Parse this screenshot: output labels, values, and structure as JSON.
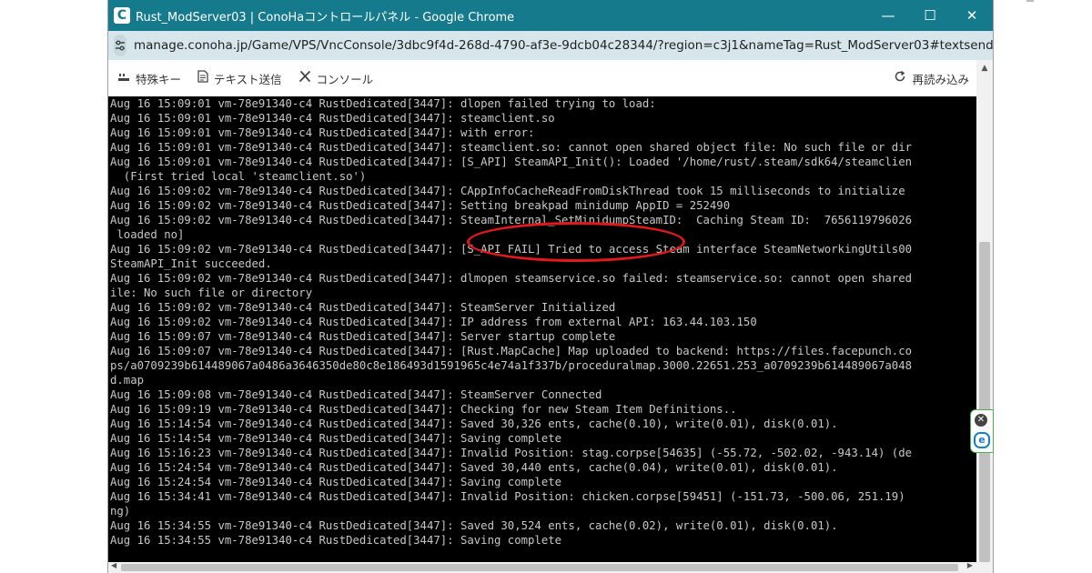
{
  "window": {
    "title": "Rust_ModServer03 | ConoHaコントロールパネル - Google Chrome",
    "app_icon": "C",
    "controls": {
      "minimize": "—",
      "maximize": "☐",
      "close": "✕"
    }
  },
  "address": {
    "url": "manage.conoha.jp/Game/VPS/VncConsole/3dbc9f4d-268d-4790-af3e-9dcb04c28344/?region=c3j1&nameTag=Rust_ModServer03#textsend"
  },
  "toolbar": {
    "special_keys": "特殊キー",
    "text_send": "テキスト送信",
    "console": "コンソール",
    "reload": "再読み込み"
  },
  "console": {
    "lines": [
      "Aug 16 15:09:01 vm-78e91340-c4 RustDedicated[3447]: dlopen failed trying to load:",
      "Aug 16 15:09:01 vm-78e91340-c4 RustDedicated[3447]: steamclient.so",
      "Aug 16 15:09:01 vm-78e91340-c4 RustDedicated[3447]: with error:",
      "Aug 16 15:09:01 vm-78e91340-c4 RustDedicated[3447]: steamclient.so: cannot open shared object file: No such file or dir",
      "Aug 16 15:09:01 vm-78e91340-c4 RustDedicated[3447]: [S_API] SteamAPI_Init(): Loaded '/home/rust/.steam/sdk64/steamclien",
      "  (First tried local 'steamclient.so')",
      "Aug 16 15:09:02 vm-78e91340-c4 RustDedicated[3447]: CAppInfoCacheReadFromDiskThread took 15 milliseconds to initialize",
      "Aug 16 15:09:02 vm-78e91340-c4 RustDedicated[3447]: Setting breakpad minidump AppID = 252490",
      "Aug 16 15:09:02 vm-78e91340-c4 RustDedicated[3447]: SteamInternal_SetMinidumpSteamID:  Caching Steam ID:  7656119796026",
      " loaded no]",
      "Aug 16 15:09:02 vm-78e91340-c4 RustDedicated[3447]: [S_API FAIL] Tried to access Steam interface SteamNetworkingUtils00",
      "SteamAPI_Init succeeded.",
      "Aug 16 15:09:02 vm-78e91340-c4 RustDedicated[3447]: dlmopen steamservice.so failed: steamservice.so: cannot open shared",
      "ile: No such file or directory",
      "Aug 16 15:09:02 vm-78e91340-c4 RustDedicated[3447]: SteamServer Initialized",
      "Aug 16 15:09:02 vm-78e91340-c4 RustDedicated[3447]: IP address from external API: 163.44.103.150",
      "Aug 16 15:09:07 vm-78e91340-c4 RustDedicated[3447]: Server startup complete",
      "Aug 16 15:09:07 vm-78e91340-c4 RustDedicated[3447]: [Rust.MapCache] Map uploaded to backend: https://files.facepunch.co",
      "ps/a0709239b614489067a0486a3646350de80c8e186493d1591965c4e74a1f337b/proceduralmap.3000.22651.253_a0709239b614489067a048",
      "d.map",
      "Aug 16 15:09:08 vm-78e91340-c4 RustDedicated[3447]: SteamServer Connected",
      "Aug 16 15:09:19 vm-78e91340-c4 RustDedicated[3447]: Checking for new Steam Item Definitions..",
      "Aug 16 15:14:54 vm-78e91340-c4 RustDedicated[3447]: Saved 30,326 ents, cache(0.10), write(0.01), disk(0.01).",
      "Aug 16 15:14:54 vm-78e91340-c4 RustDedicated[3447]: Saving complete",
      "Aug 16 15:16:23 vm-78e91340-c4 RustDedicated[3447]: Invalid Position: stag.corpse[54635] (-55.72, -502.02, -943.14) (de",
      "Aug 16 15:24:54 vm-78e91340-c4 RustDedicated[3447]: Saved 30,440 ents, cache(0.04), write(0.01), disk(0.01).",
      "Aug 16 15:24:54 vm-78e91340-c4 RustDedicated[3447]: Saving complete",
      "Aug 16 15:34:41 vm-78e91340-c4 RustDedicated[3447]: Invalid Position: chicken.corpse[59451] (-151.73, -500.06, 251.19)",
      "ng)",
      "Aug 16 15:34:55 vm-78e91340-c4 RustDedicated[3447]: Saved 30,524 ents, cache(0.02), write(0.01), disk(0.01).",
      "Aug 16 15:34:55 vm-78e91340-c4 RustDedicated[3447]: Saving complete"
    ]
  },
  "side_widget": {
    "close_glyph": "✕",
    "e_glyph": "e"
  },
  "colors": {
    "titlebar": "#147a8c",
    "addressbar": "#d7e6ea",
    "console_bg": "#000000",
    "console_text": "#c8c8c8",
    "highlight": "#e0191c"
  }
}
